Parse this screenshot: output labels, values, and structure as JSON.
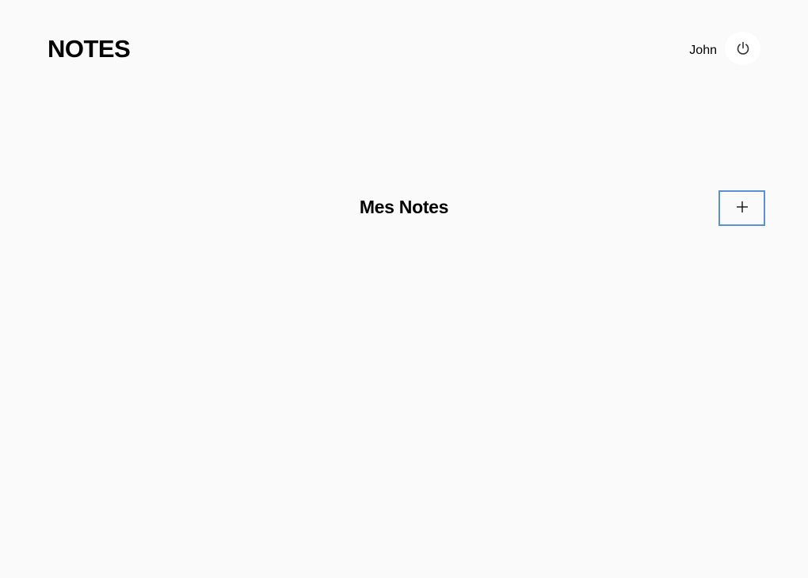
{
  "header": {
    "app_title": "NOTES",
    "user_name": "John",
    "logout_icon": "power-icon"
  },
  "main": {
    "section_title": "Mes Notes",
    "add_icon": "plus-icon"
  },
  "colors": {
    "background": "#fafafa",
    "add_button_border": "#5b8fd8",
    "logout_button_bg": "#ffffff"
  }
}
